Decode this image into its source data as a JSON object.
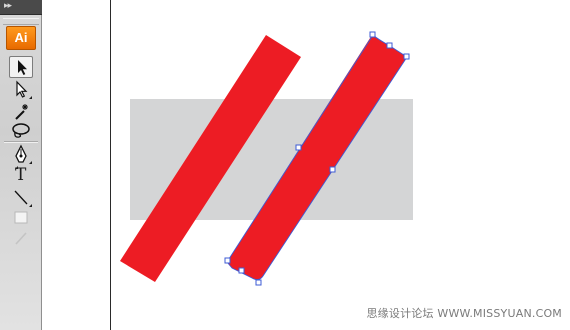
{
  "toolbar": {
    "collapse_glyph": "▸▸",
    "app_badge": "Ai",
    "tools": [
      {
        "name": "selection-tool",
        "icon": "black-arrow-icon",
        "active": true
      },
      {
        "name": "direct-selection-tool",
        "icon": "white-arrow-icon",
        "active": false
      },
      {
        "name": "magic-wand-tool",
        "icon": "magic-wand-icon",
        "active": false
      },
      {
        "name": "lasso-tool",
        "icon": "lasso-icon",
        "active": false
      },
      {
        "name": "pen-tool",
        "icon": "pen-nib-icon",
        "active": false
      },
      {
        "name": "type-tool",
        "icon": "type-icon",
        "label": "T",
        "active": false
      },
      {
        "name": "line-segment-tool",
        "icon": "line-segment-icon",
        "active": false
      },
      {
        "name": "rectangle-tool",
        "icon": "rectangle-icon",
        "active": false
      },
      {
        "name": "paintbrush-tool",
        "icon": "paintbrush-icon",
        "active": false
      }
    ]
  },
  "canvas": {
    "background_color": "#ffffff",
    "shapes": [
      {
        "name": "gray-rectangle",
        "fill": "#d4d5d6"
      },
      {
        "name": "red-slash-left",
        "fill": "#ed1c24"
      },
      {
        "name": "red-slash-right",
        "fill": "#ed1c24",
        "selected": true,
        "selection_color": "#3c5bd6"
      }
    ]
  },
  "watermark": {
    "text": "思缘设计论坛 WWW.MISSYUAN.COM"
  }
}
